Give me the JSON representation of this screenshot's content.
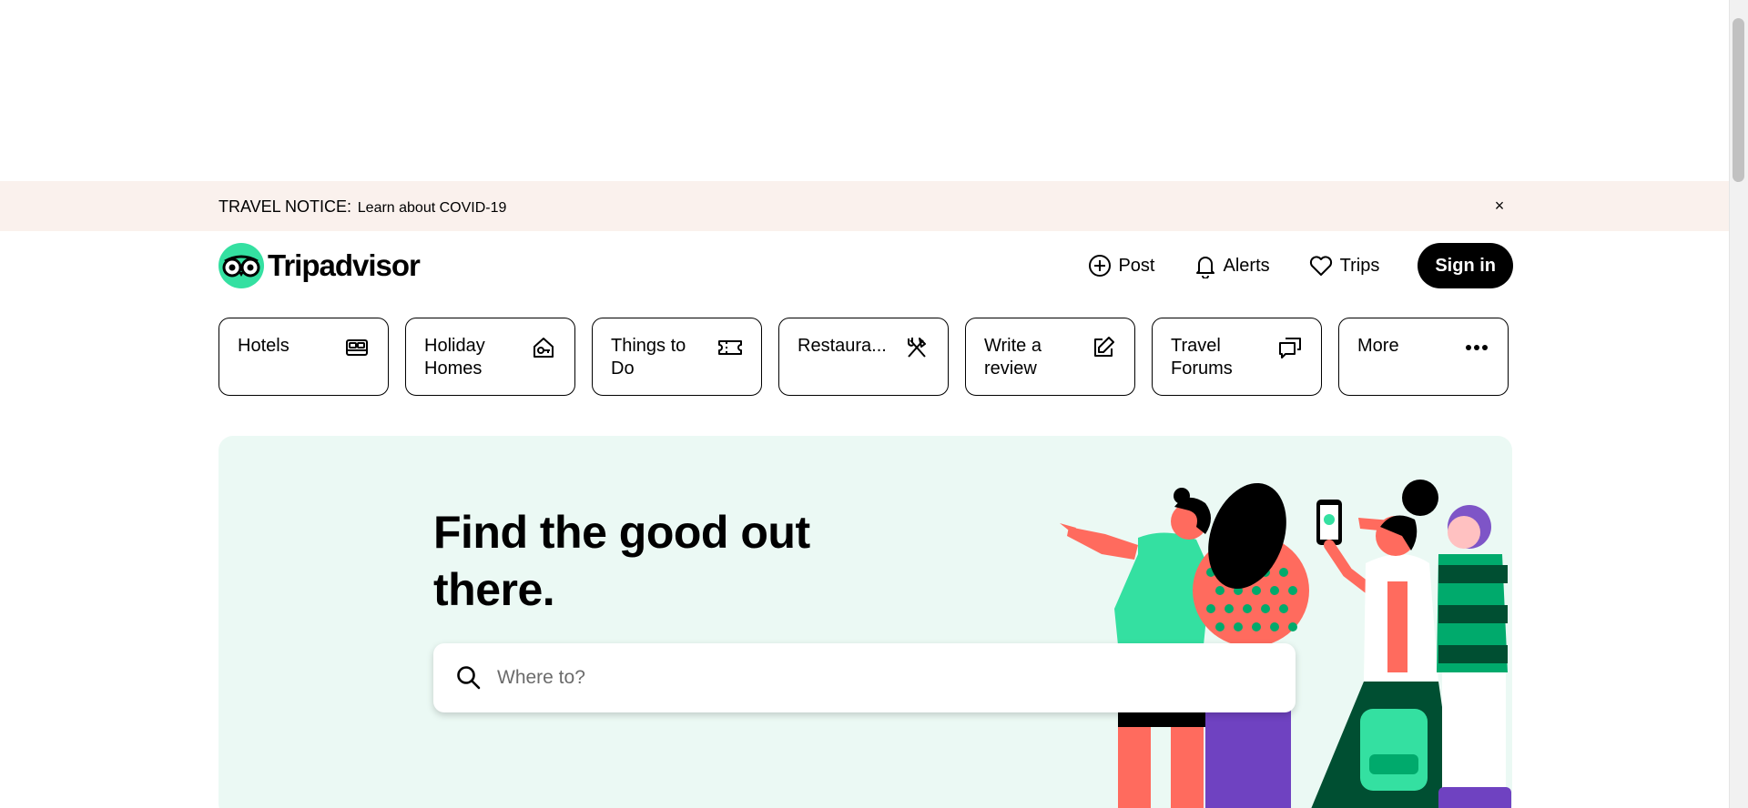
{
  "notice": {
    "label": "TRAVEL NOTICE:",
    "link": "Learn about COVID-19",
    "close_glyph": "×"
  },
  "brand": {
    "name": "Tripadvisor",
    "accent": "#34e0a1"
  },
  "header": {
    "post": "Post",
    "alerts": "Alerts",
    "trips": "Trips",
    "signin": "Sign in"
  },
  "tiles": [
    {
      "label": "Hotels",
      "icon": "bed-icon"
    },
    {
      "label": "Holiday Homes",
      "icon": "house-key-icon"
    },
    {
      "label": "Things to Do",
      "icon": "ticket-icon"
    },
    {
      "label": "Restaura...",
      "icon": "fork-knife-icon"
    },
    {
      "label": "Write a review",
      "icon": "pencil-square-icon"
    },
    {
      "label": "Travel Forums",
      "icon": "chat-bubbles-icon"
    },
    {
      "label": "More",
      "icon": "more-dots-icon"
    }
  ],
  "hero": {
    "title": "Find the good out there.",
    "search_placeholder": "Where to?",
    "background": "#ebf9f4"
  }
}
